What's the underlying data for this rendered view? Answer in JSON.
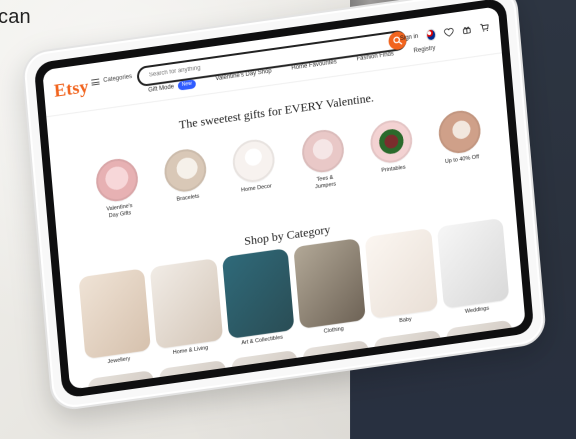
{
  "page": {
    "top_left_text": "can"
  },
  "etsy": {
    "logo": "Etsy",
    "header": {
      "categories_label": "Categories",
      "search_placeholder": "Search for anything",
      "signin_label": "Sign in"
    },
    "subnav": {
      "gift_mode_label": "Gift Mode",
      "gift_mode_badge": "New",
      "items": [
        "Valentine's Day Shop",
        "Home Favourites",
        "Fashion Finds",
        "Registry"
      ]
    },
    "hero": {
      "title": "The sweetest gifts for EVERY Valentine."
    },
    "circles": [
      {
        "label": "Valentine's\nDay Gifts",
        "img": "valentine"
      },
      {
        "label": "Bracelets",
        "img": "bracelets"
      },
      {
        "label": "Home Decor",
        "img": "decor"
      },
      {
        "label": "Tees &\nJumpers",
        "img": "tees"
      },
      {
        "label": "Printables",
        "img": "print"
      },
      {
        "label": "Up to 40% Off",
        "img": "sale"
      }
    ],
    "shop_by_category": {
      "title": "Shop by Category",
      "cards": [
        {
          "label": "Jewellery"
        },
        {
          "label": "Home & Living"
        },
        {
          "label": "Art & Collectibles"
        },
        {
          "label": "Clothing"
        },
        {
          "label": "Baby"
        },
        {
          "label": "Weddings"
        }
      ]
    }
  }
}
